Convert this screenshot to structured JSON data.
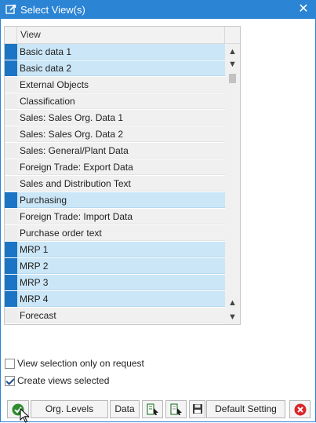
{
  "dialog": {
    "title": "Select View(s)",
    "close_icon": "close-icon",
    "app_icon": "select-view-icon"
  },
  "table": {
    "column_header": "View",
    "rows": [
      {
        "label": "Basic data 1",
        "selected": true
      },
      {
        "label": "Basic data 2",
        "selected": true
      },
      {
        "label": "External Objects",
        "selected": false
      },
      {
        "label": "Classification",
        "selected": false
      },
      {
        "label": "Sales: Sales Org. Data 1",
        "selected": false
      },
      {
        "label": "Sales: Sales Org. Data 2",
        "selected": false
      },
      {
        "label": "Sales: General/Plant Data",
        "selected": false
      },
      {
        "label": "Foreign Trade: Export Data",
        "selected": false
      },
      {
        "label": "Sales and Distribution Text",
        "selected": false
      },
      {
        "label": "Purchasing",
        "selected": true
      },
      {
        "label": "Foreign Trade: Import Data",
        "selected": false
      },
      {
        "label": "Purchase order text",
        "selected": false
      },
      {
        "label": "MRP 1",
        "selected": true
      },
      {
        "label": "MRP 2",
        "selected": true
      },
      {
        "label": "MRP 3",
        "selected": true
      },
      {
        "label": "MRP 4",
        "selected": true
      },
      {
        "label": "Forecast",
        "selected": false
      }
    ]
  },
  "options": {
    "view_selection_on_request": {
      "label": "View selection only on request",
      "checked": false
    },
    "create_views_selected": {
      "label": "Create views selected",
      "checked": true
    }
  },
  "buttons": {
    "ok": {
      "icon": "checkmark-icon"
    },
    "org_levels": {
      "label": "Org. Levels"
    },
    "data": {
      "label": "Data"
    },
    "select_all": {
      "icon": "select-all-icon"
    },
    "deselect_all": {
      "icon": "deselect-all-icon"
    },
    "save_default": {
      "icon": "save-icon"
    },
    "default_setting": {
      "label": "Default Setting"
    },
    "cancel": {
      "icon": "cancel-icon"
    }
  },
  "colors": {
    "title_bar": "#2b84d4",
    "selected_row": "#cbe6f7",
    "selected_marker": "#1c74c4",
    "ok_green": "#2e8b2e",
    "cancel_red": "#d9262b"
  }
}
